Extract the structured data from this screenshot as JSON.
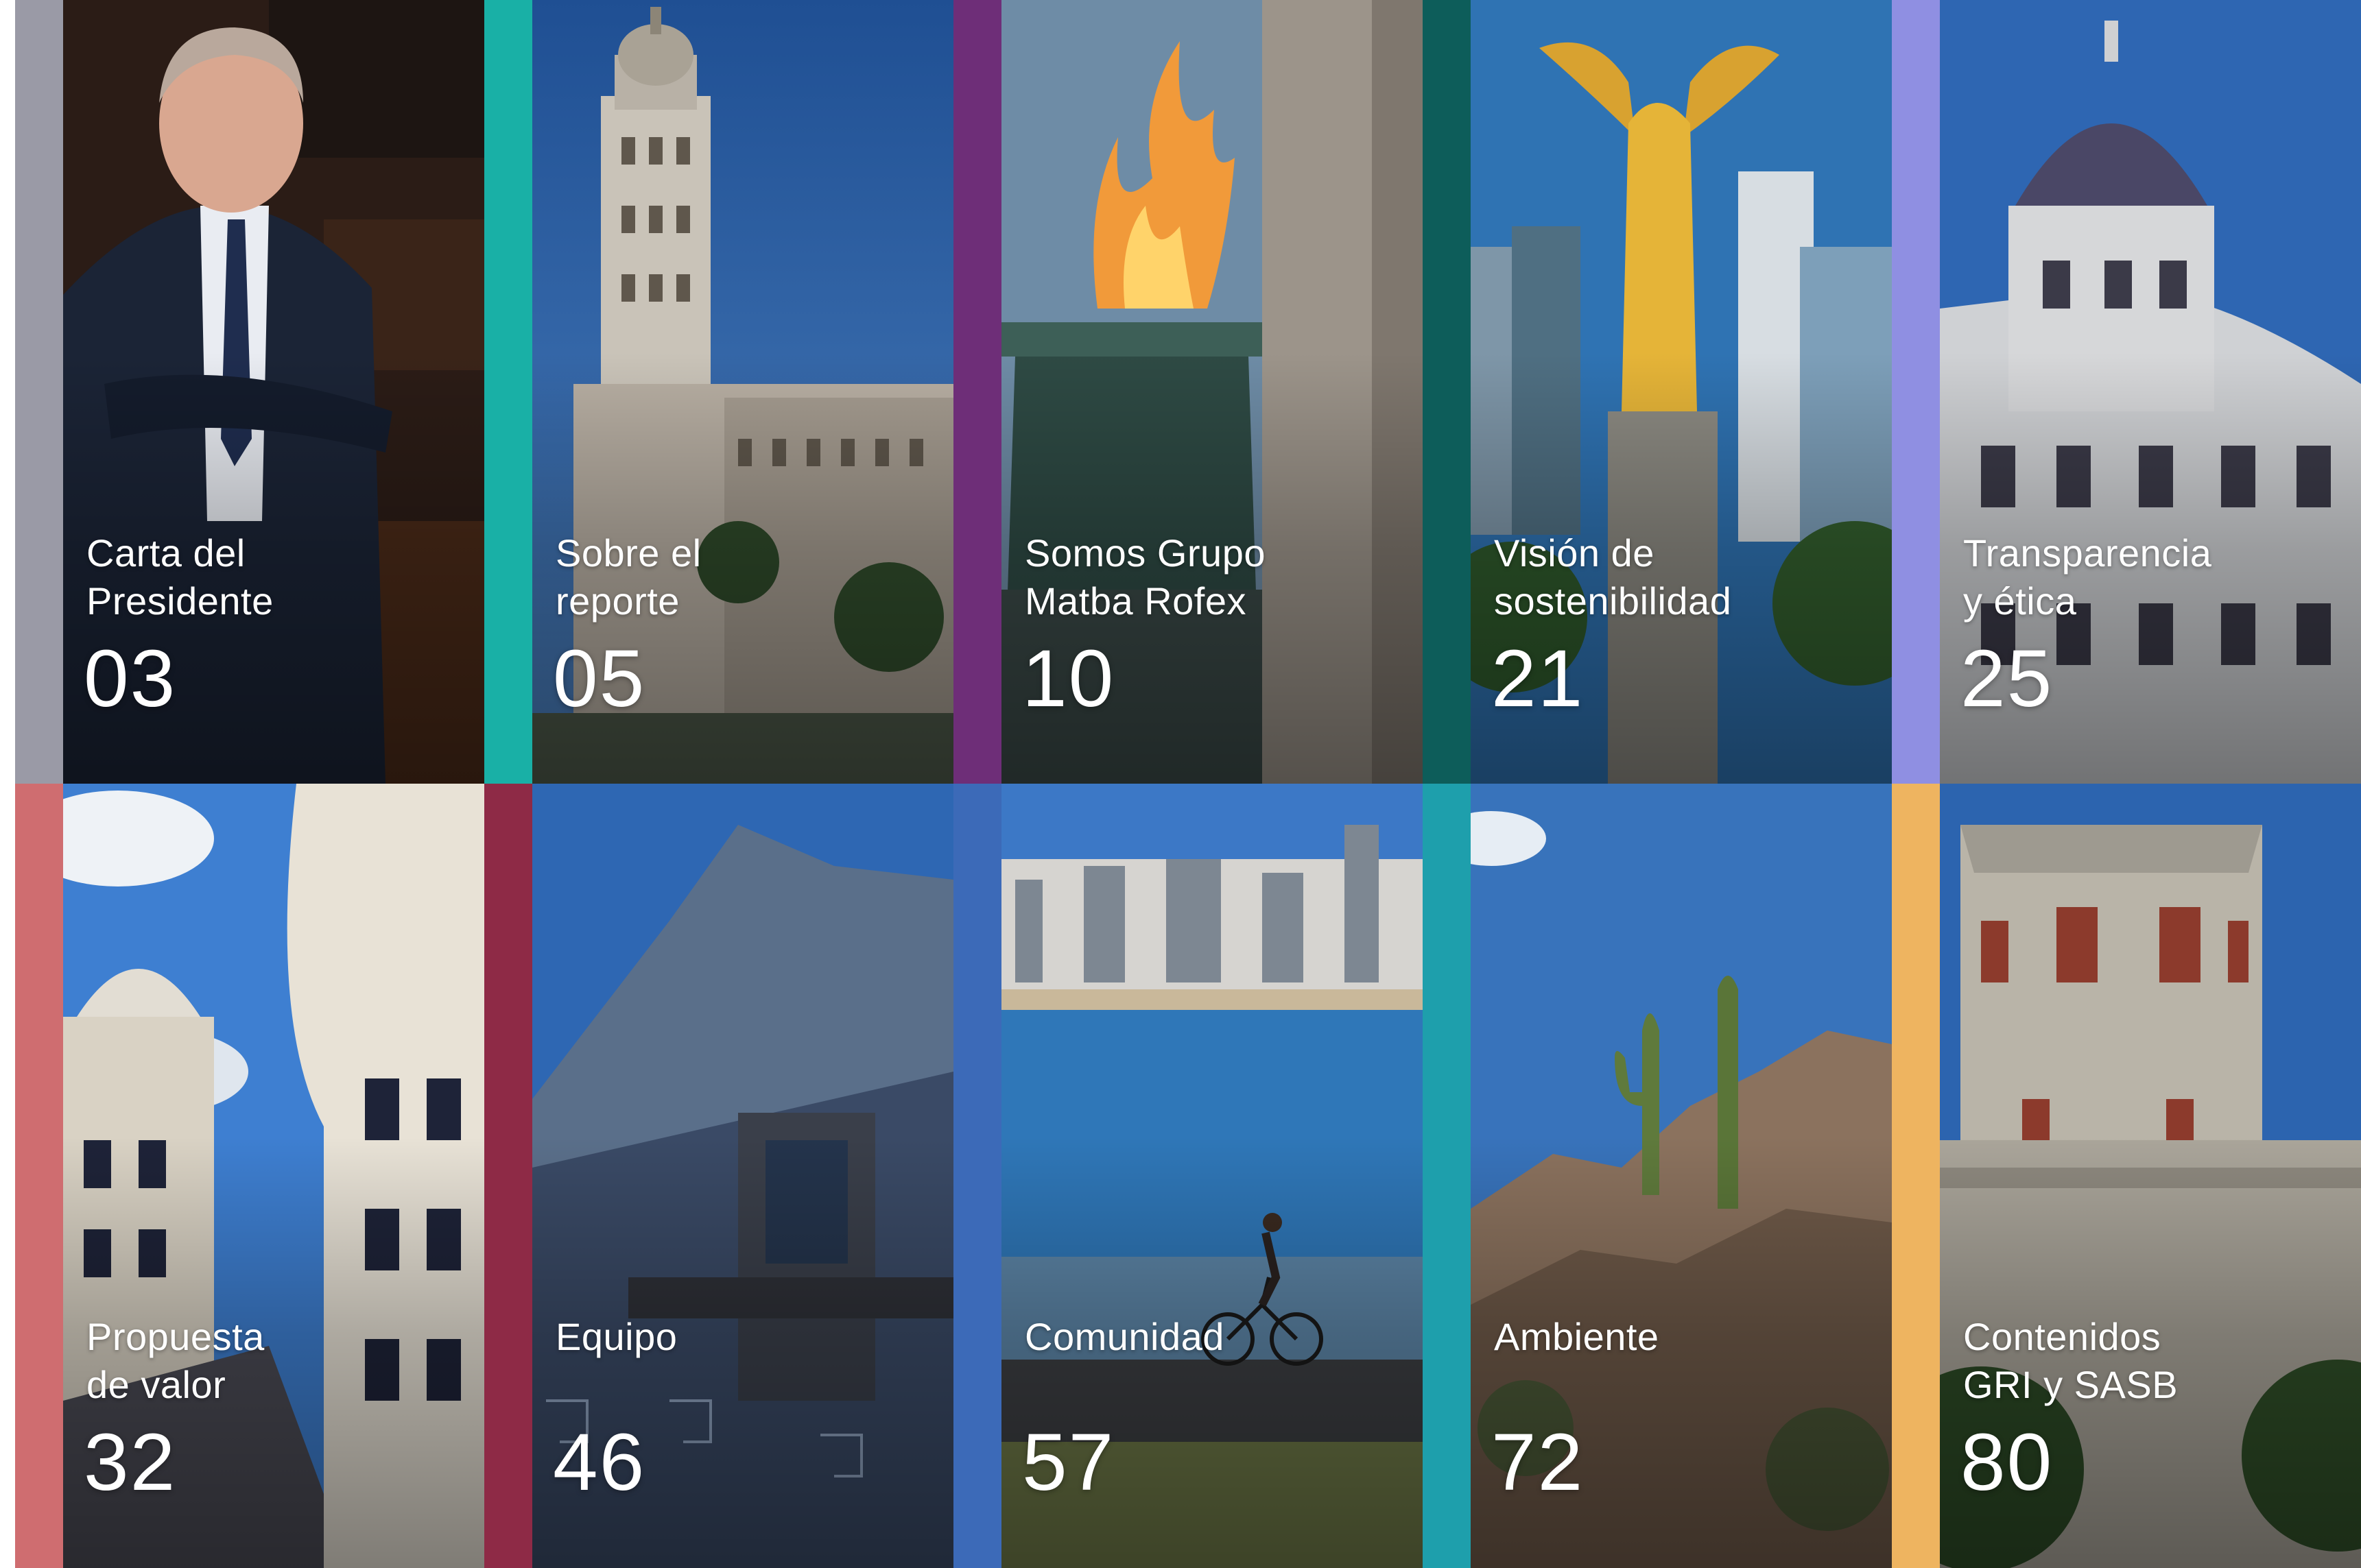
{
  "sections": [
    {
      "title": "Carta del\nPresidente",
      "page": "03",
      "accent": "#9a9aa6",
      "photo": "president-portrait"
    },
    {
      "title": "Sobre el\nreporte",
      "page": "05",
      "accent": "#19b0a6",
      "photo": "palacio-salvo"
    },
    {
      "title": "Somos Grupo\nMatba Rofex",
      "page": "10",
      "accent": "#6e2e78",
      "photo": "eternal-flame"
    },
    {
      "title": "Visión de\nsostenibilidad",
      "page": "21",
      "accent": "#0d5d5a",
      "photo": "angel-independencia"
    },
    {
      "title": "Transparencia\ny ética",
      "page": "25",
      "accent": "#8f8fe2",
      "photo": "domed-building"
    },
    {
      "title": "Propuesta\nde valor",
      "page": "32",
      "accent": "#cf6d70",
      "photo": "buenos-aires-towers"
    },
    {
      "title": "Equipo",
      "page": "46",
      "accent": "#8e2a46",
      "photo": "casa-azulejos"
    },
    {
      "title": "Comunidad",
      "page": "57",
      "accent": "#3c6ab8",
      "photo": "rambla-cyclist"
    },
    {
      "title": "Ambiente",
      "page": "72",
      "accent": "#1e9fac",
      "photo": "cactus-rocks"
    },
    {
      "title": "Contenidos\nGRI y SASB",
      "page": "80",
      "accent": "#eeb460",
      "photo": "castle-tower"
    }
  ]
}
